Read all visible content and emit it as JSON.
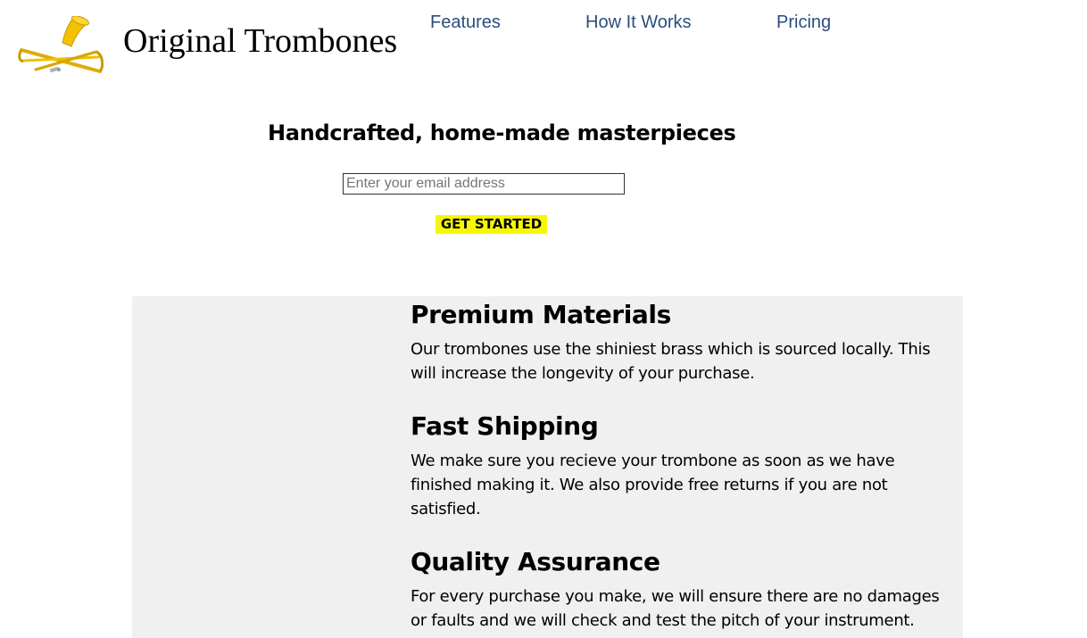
{
  "header": {
    "brand": "Original Trombones",
    "logo_icon": "trombone-icon",
    "nav": [
      {
        "label": "Features"
      },
      {
        "label": "How It Works"
      },
      {
        "label": "Pricing"
      }
    ],
    "nav_color": "#2a4e7c"
  },
  "hero": {
    "title": "Handcrafted, home-made masterpieces",
    "email_placeholder": "Enter your email address",
    "email_value": "",
    "cta_label": "GET STARTED",
    "cta_color": "#f7f700"
  },
  "features": {
    "panel_color": "#f0f0f0",
    "items": [
      {
        "title": "Premium Materials",
        "body": "Our trombones use the shiniest brass which is sourced locally. This will increase the longevity of your purchase."
      },
      {
        "title": "Fast Shipping",
        "body": "We make sure you recieve your trombone as soon as we have finished making it. We also provide free returns if you are not satisfied."
      },
      {
        "title": "Quality Assurance",
        "body": "For every purchase you make, we will ensure there are no damages or faults and we will check and test the pitch of your instrument."
      }
    ]
  }
}
